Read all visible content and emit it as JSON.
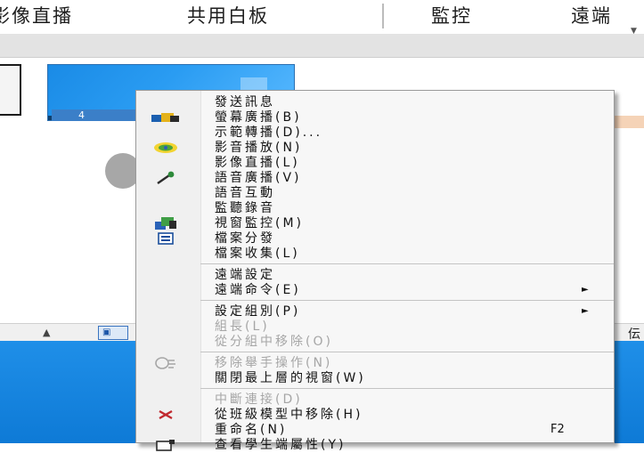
{
  "toolbar": {
    "tabs": [
      "影像直播",
      "共用白板",
      "監控",
      "遠端"
    ]
  },
  "thumbnail": {
    "label": "4"
  },
  "scrollbar": {
    "right_text": "伝"
  },
  "context_menu": {
    "items": [
      {
        "label": "發送訊息",
        "icon": null,
        "enabled": true
      },
      {
        "label": "螢幕廣播(B)",
        "icon": "broadcast-icon",
        "enabled": true
      },
      {
        "label": "示範轉播(D)...",
        "icon": null,
        "enabled": true
      },
      {
        "label": "影音播放(N)",
        "icon": "media-play-icon",
        "enabled": true
      },
      {
        "label": "影像直播(L)",
        "icon": null,
        "enabled": true
      },
      {
        "label": "語音廣播(V)",
        "icon": "microphone-icon",
        "enabled": true
      },
      {
        "label": "語音互動",
        "icon": null,
        "enabled": true
      },
      {
        "label": "監聽錄音",
        "icon": null,
        "enabled": true
      },
      {
        "label": "視窗監控(M)",
        "icon": "monitor-icon",
        "enabled": true
      },
      {
        "label": "檔案分發",
        "icon": "file-distribute-icon",
        "enabled": true
      },
      {
        "label": "檔案收集(L)",
        "icon": null,
        "enabled": true
      },
      {
        "label": "遠端設定",
        "icon": null,
        "enabled": true
      },
      {
        "label": "遠端命令(E)",
        "icon": null,
        "enabled": true,
        "submenu": true
      },
      {
        "label": "設定組別(P)",
        "icon": null,
        "enabled": true,
        "submenu": true
      },
      {
        "label": "組長(L)",
        "icon": null,
        "enabled": false
      },
      {
        "label": "從分組中移除(O)",
        "icon": null,
        "enabled": false
      },
      {
        "label": "移除舉手操作(N)",
        "icon": "hand-raise-icon",
        "enabled": false
      },
      {
        "label": "關閉最上層的視窗(W)",
        "icon": null,
        "enabled": true
      },
      {
        "label": "中斷連接(D)",
        "icon": null,
        "enabled": false
      },
      {
        "label": "從班級模型中移除(H)",
        "icon": "remove-x-icon",
        "enabled": true
      },
      {
        "label": "重命名(N)",
        "icon": null,
        "enabled": true,
        "shortcut": "F2"
      },
      {
        "label": "查看學生端屬性(Y)",
        "icon": "properties-icon",
        "enabled": true
      }
    ]
  },
  "colors": {
    "menu_bg": "#f7f7f7",
    "disabled_text": "#a6a6a6",
    "taskbar_blue": "#1f8fe8",
    "remove_red": "#c0282e"
  }
}
